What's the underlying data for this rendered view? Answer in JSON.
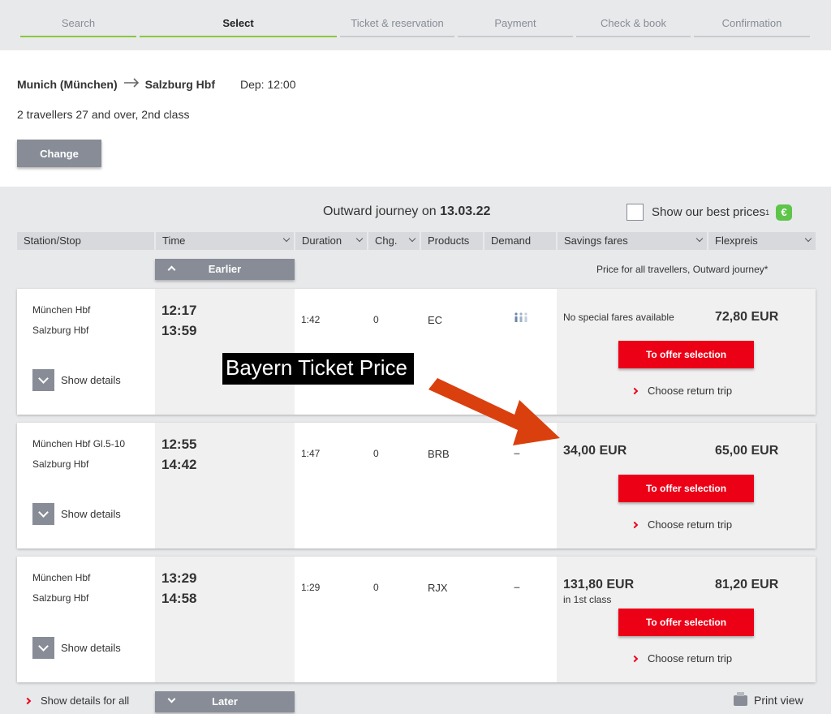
{
  "steps": [
    "Search",
    "Select",
    "Ticket & reservation",
    "Payment",
    "Check & book",
    "Confirmation"
  ],
  "summary": {
    "from": "Munich (München)",
    "to": "Salzburg Hbf",
    "dep": "Dep: 12:00",
    "travellers": "2 travellers 27 and over, 2nd class",
    "change_label": "Change"
  },
  "results": {
    "title_prefix": "Outward journey on",
    "date": "13.03.22",
    "best_prices_label": "Show our best prices",
    "best_prices_sup": "1",
    "euro_badge": "€",
    "columns": [
      "Station/Stop",
      "Time",
      "Duration",
      "Chg.",
      "Products",
      "Demand",
      "Savings fares",
      "Flexpreis"
    ],
    "earlier_label": "Earlier",
    "later_label": "Later",
    "price_note": "Price for all travellers, Outward journey*"
  },
  "journeys": [
    {
      "from": "München Hbf",
      "to": "Salzburg Hbf",
      "dep": "12:17",
      "arr": "13:59",
      "duration": "1:42",
      "changes": "0",
      "product": "EC",
      "demand": "",
      "savings": "No special fares available",
      "savings_sub": "",
      "flex": "72,80 EUR",
      "details_label": "Show details",
      "offer_label": "To offer selection",
      "return_label": "Choose return trip"
    },
    {
      "from": "München Hbf Gl.5-10",
      "to": "Salzburg Hbf",
      "dep": "12:55",
      "arr": "14:42",
      "duration": "1:47",
      "changes": "0",
      "product": "BRB",
      "demand": "–",
      "savings": "34,00 EUR",
      "savings_sub": "",
      "flex": "65,00 EUR",
      "details_label": "Show details",
      "offer_label": "To offer selection",
      "return_label": "Choose return trip"
    },
    {
      "from": "München Hbf",
      "to": "Salzburg Hbf",
      "dep": "13:29",
      "arr": "14:58",
      "duration": "1:29",
      "changes": "0",
      "product": "RJX",
      "demand": "–",
      "savings": "131,80 EUR",
      "savings_sub": "in 1st class",
      "flex": "81,20 EUR",
      "details_label": "Show details",
      "offer_label": "To offer selection",
      "return_label": "Choose return trip"
    }
  ],
  "annotation": {
    "label": "Bayern Ticket Price",
    "color": "#d9400e"
  },
  "footer": {
    "show_all_label": "Show details for all",
    "print_label": "Print view"
  },
  "colors": {
    "accent": "#ec0016",
    "progress": "#8cc63e",
    "button_grey": "#878c96"
  }
}
